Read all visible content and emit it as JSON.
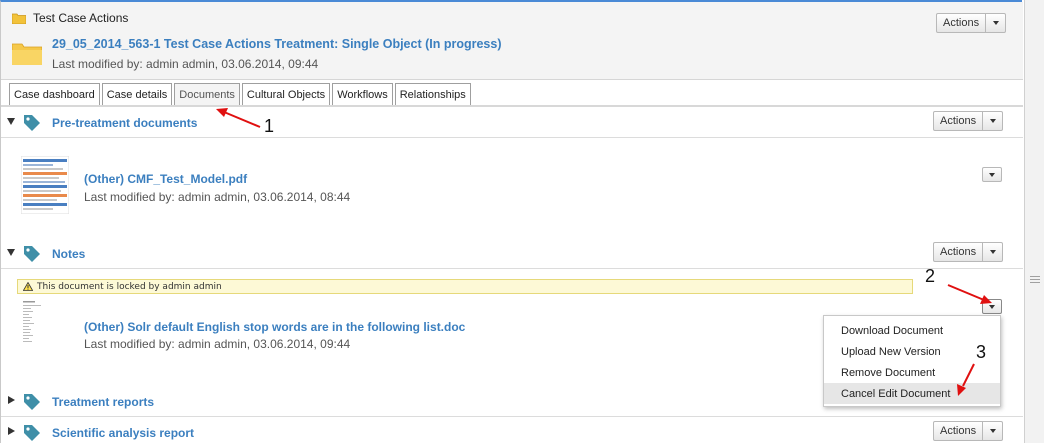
{
  "header": {
    "breadcrumb": "Test Case Actions",
    "title": "29_05_2014_563-1 Test Case Actions Treatment: Single Object (In progress)",
    "subtitle": "Last modified by: admin admin, 03.06.2014, 09:44",
    "actions_label": "Actions"
  },
  "tabs": [
    {
      "label": "Case dashboard"
    },
    {
      "label": "Case details"
    },
    {
      "label": "Documents",
      "active": true
    },
    {
      "label": "Cultural Objects"
    },
    {
      "label": "Workflows"
    },
    {
      "label": "Relationships"
    }
  ],
  "sections": {
    "pretreatment": {
      "name": "Pre-treatment documents",
      "actions_label": "Actions",
      "doc_title": "(Other) CMF_Test_Model.pdf",
      "doc_sub": "Last modified by: admin admin, 03.06.2014, 08:44"
    },
    "notes": {
      "name": "Notes",
      "actions_label": "Actions",
      "lock_message": "This document is locked by admin admin",
      "doc_title": "(Other) Solr default English stop words are in the following list.doc",
      "doc_sub": "Last modified by: admin admin, 03.06.2014, 09:44"
    },
    "treatment": {
      "name": "Treatment reports"
    },
    "scientific": {
      "name": "Scientific analysis report",
      "actions_label": "Actions"
    }
  },
  "doc_menu": {
    "items": [
      {
        "label": "Download Document"
      },
      {
        "label": "Upload New Version"
      },
      {
        "label": "Remove Document"
      },
      {
        "label": "Cancel Edit Document"
      }
    ]
  },
  "annotations": {
    "n1": "1",
    "n2": "2",
    "n3": "3"
  },
  "colors": {
    "link_blue": "#3b7fbf",
    "annotation_red": "#e01010",
    "tag_teal": "#3f8fa8",
    "folder_yellow": "#f2c23a"
  },
  "icons": [
    "folder-icon",
    "tag-icon",
    "warning-icon",
    "caret-down-icon",
    "pdf-thumbnail",
    "doc-thumbnail"
  ]
}
